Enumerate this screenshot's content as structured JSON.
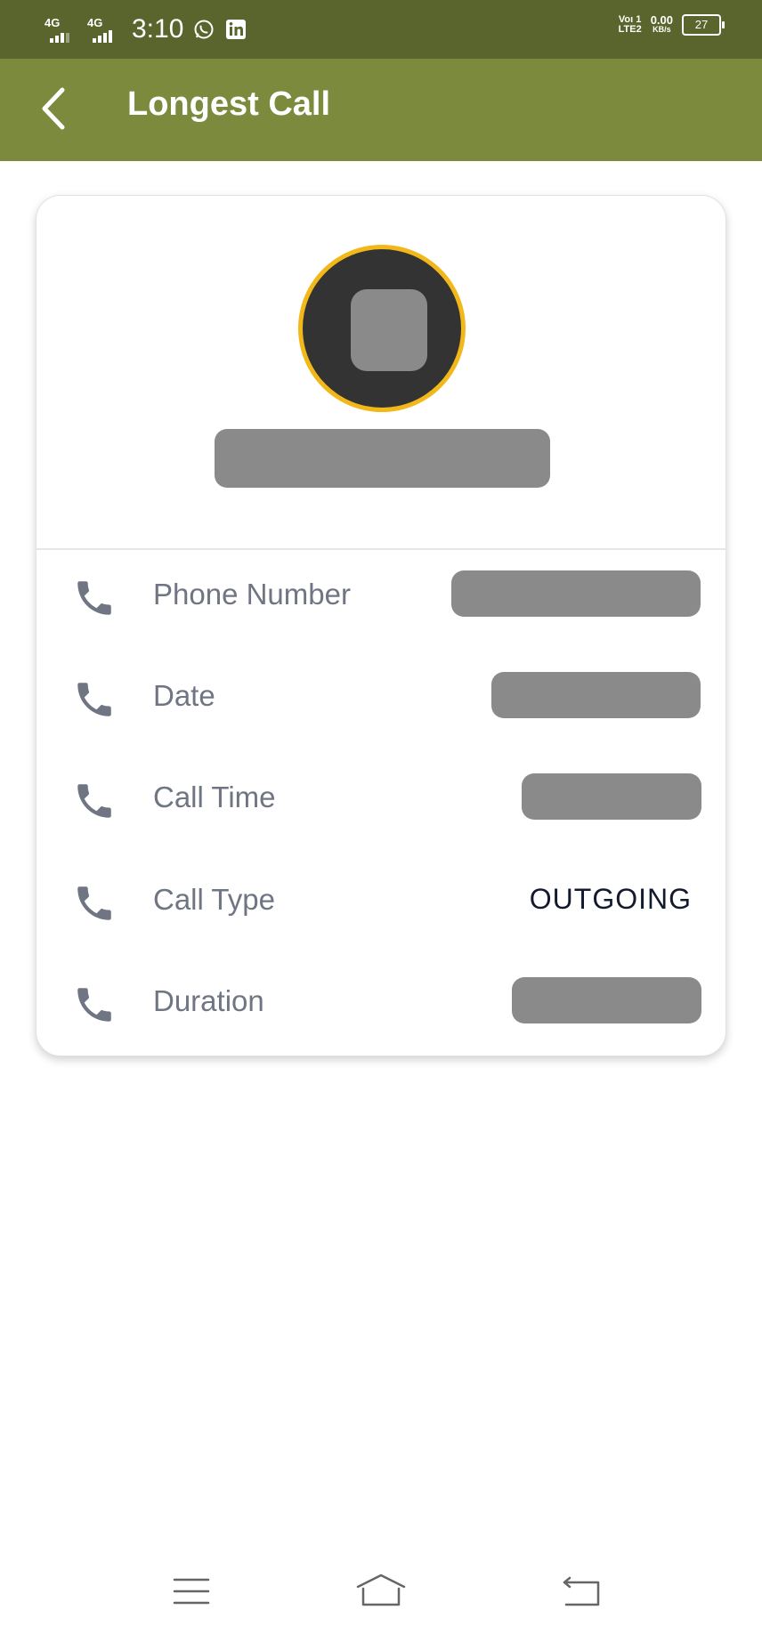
{
  "status_bar": {
    "sim1_network": "4G",
    "sim2_network": "4G",
    "time": "3:10",
    "volte_line1": "Voı 1",
    "volte_line2": "LTE2",
    "speed_value": "0.00",
    "speed_unit": "KB/s",
    "battery_level": "27"
  },
  "app_bar": {
    "title": "Longest Call"
  },
  "card": {
    "rows": [
      {
        "label": "Phone Number",
        "value": "",
        "redacted": true
      },
      {
        "label": "Date",
        "value": "",
        "redacted": true
      },
      {
        "label": "Call Time",
        "value": "",
        "redacted": true
      },
      {
        "label": "Call Type",
        "value": "OUTGOING",
        "redacted": false
      },
      {
        "label": "Duration",
        "value": "",
        "redacted": true
      }
    ]
  },
  "colors": {
    "status_bar_bg": "#5a652d",
    "app_bar_bg": "#7b8a3c",
    "avatar_ring": "#f2b81a",
    "avatar_bg": "#333333",
    "icon_color": "#6f7582",
    "redaction": "#8a8a8a"
  }
}
